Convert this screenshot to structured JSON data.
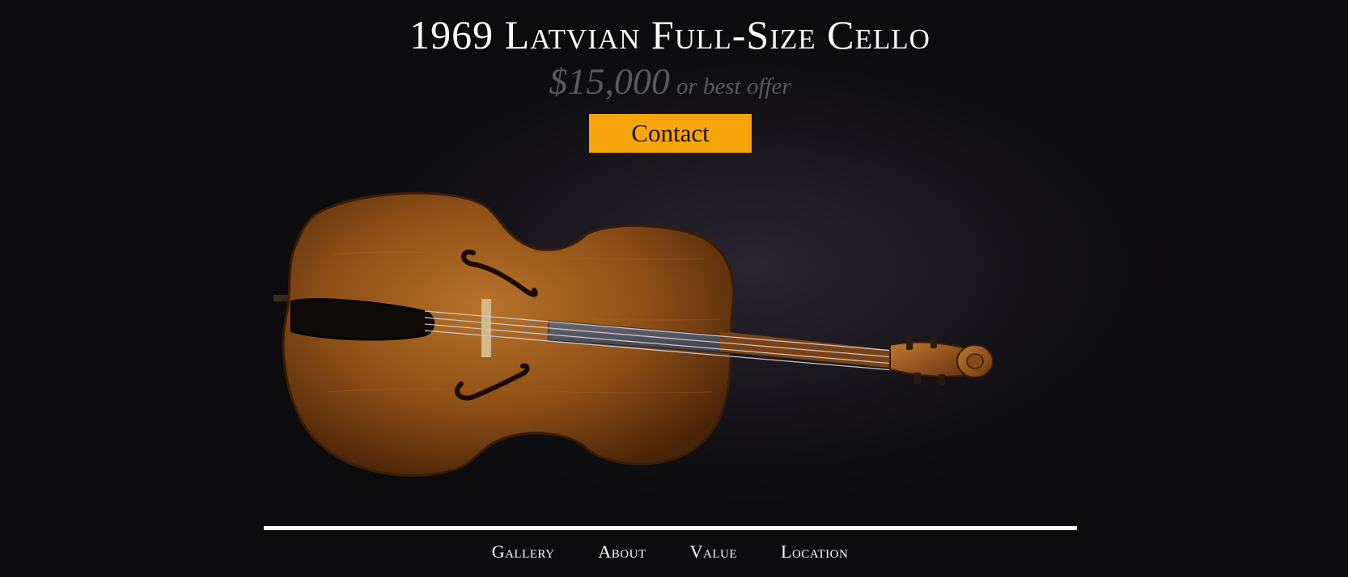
{
  "hero": {
    "title": "1969 Latvian Full-Size Cello",
    "price": "$15,000",
    "price_suffix": "or best offer",
    "contact_label": "Contact"
  },
  "nav": {
    "items": [
      {
        "label": "Gallery"
      },
      {
        "label": "About"
      },
      {
        "label": "Value"
      },
      {
        "label": "Location"
      }
    ]
  },
  "colors": {
    "background": "#0c0b0d",
    "accent": "#f6a50c",
    "price": "#5a5a5e",
    "cello_wood": "#9a5a1c"
  },
  "images": {
    "hero_photo": "cello-photo"
  }
}
